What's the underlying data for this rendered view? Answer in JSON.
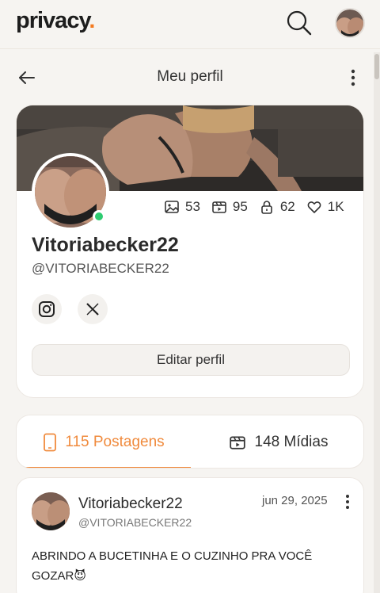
{
  "header": {
    "logo_text": "privacy",
    "logo_dot": ".",
    "brand_color": "#f47a20",
    "search_icon": "search-icon"
  },
  "subheader": {
    "title": "Meu perfil",
    "back_icon": "arrow-left-icon",
    "menu_icon": "vertical-dots-icon"
  },
  "profile": {
    "display_name": "Vitoriabecker22",
    "handle": "@VITORIABECKER22",
    "online_color": "#2ecc71",
    "stats": {
      "photos": "53",
      "videos": "95",
      "locked": "62",
      "likes": "1K"
    },
    "social": {
      "instagram_icon": "instagram-icon",
      "x_label": "𝕏"
    },
    "edit_label": "Editar perfil"
  },
  "tabs": {
    "posts_label": "115 Postagens",
    "media_label": "148 Mídias",
    "active_color": "#f08a3c"
  },
  "post": {
    "author": "Vitoriabecker22",
    "handle": "@VITORIABECKER22",
    "date": "jun 29, 2025",
    "text": "ABRINDO A BUCETINHA E O CUZINHO PRA VOCÊ GOZAR😈"
  }
}
